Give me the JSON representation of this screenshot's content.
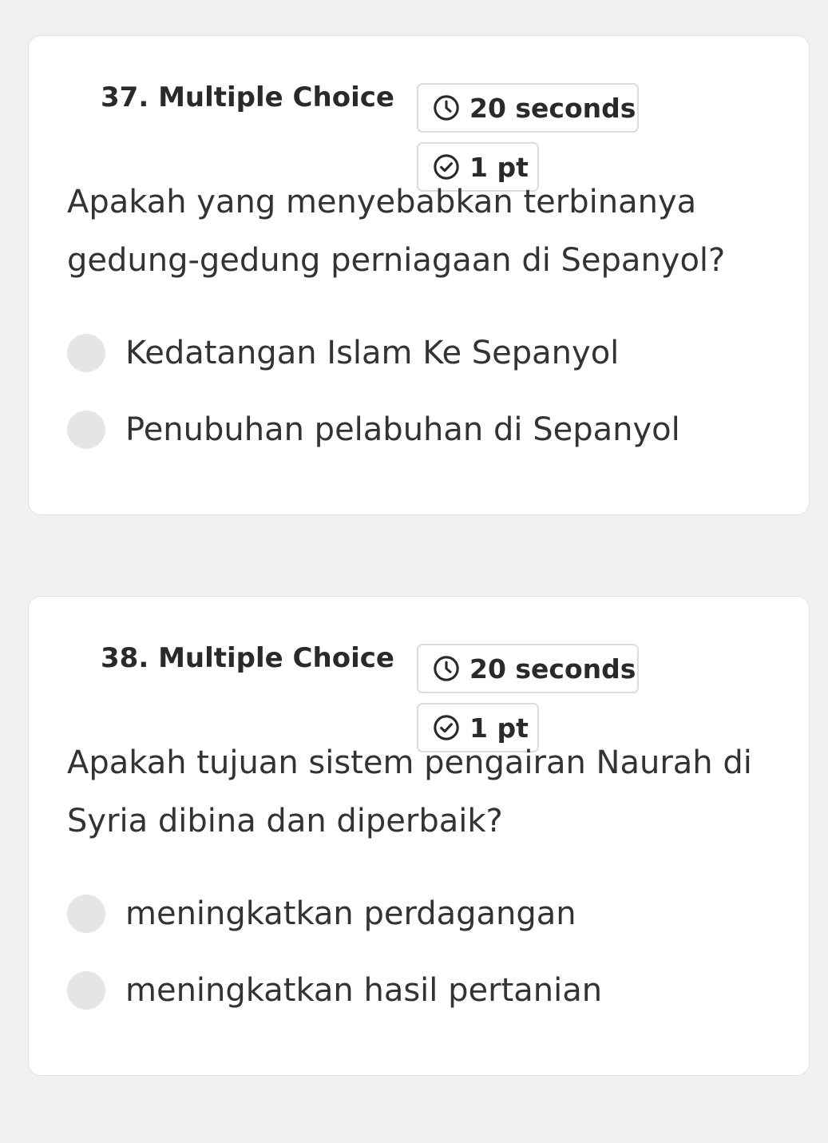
{
  "questions": [
    {
      "type_label": "37. Multiple Choice",
      "time_label": "20 seconds",
      "points_label": "1 pt",
      "text": "Apakah yang menyebabkan terbinanya gedung-gedung perniagaan di Sepanyol?",
      "options": [
        {
          "label": "Kedatangan Islam Ke Sepanyol"
        },
        {
          "label": "Penubuhan pelabuhan di Sepanyol"
        }
      ]
    },
    {
      "type_label": "38. Multiple Choice",
      "time_label": "20 seconds",
      "points_label": "1 pt",
      "text": "Apakah tujuan sistem pengairan Naurah di Syria dibina dan diperbaik?",
      "options": [
        {
          "label": "meningkatkan perdagangan"
        },
        {
          "label": "meningkatkan hasil pertanian"
        }
      ]
    }
  ],
  "icons": {
    "time": "clock-icon",
    "points": "check-circle-icon"
  },
  "colors": {
    "background": "#f1f1f1",
    "card": "#ffffff",
    "radio": "#e5e5e5",
    "text": "#333333"
  }
}
